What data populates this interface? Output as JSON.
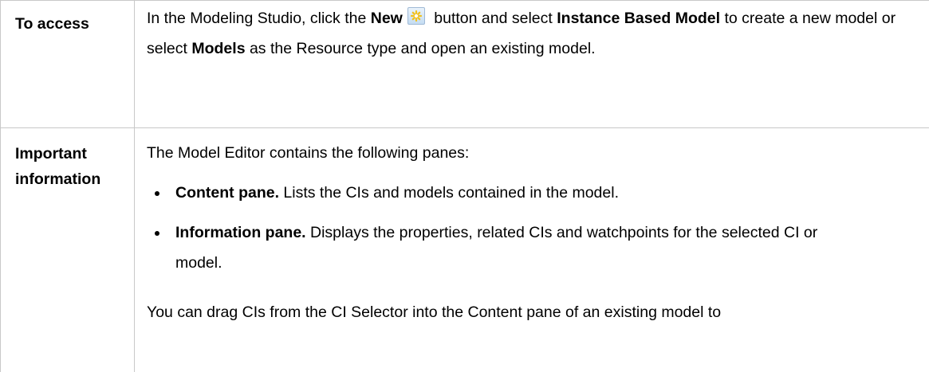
{
  "table": {
    "rows": [
      {
        "label": "To access",
        "content": {
          "text_1": "In the Modeling Studio, click the ",
          "bold_1": "New",
          "icon": "new-star-icon",
          "text_2": " button and select ",
          "bold_2": "Instance Based Model",
          "text_3": " to create a new model or select ",
          "bold_3": "Models",
          "text_4": " as the Resource type and open an existing model."
        }
      },
      {
        "label": "Important information",
        "content": {
          "intro": "The Model Editor contains the following panes:",
          "bullets": [
            {
              "bold": "Content pane.",
              "text": " Lists the CIs and models contained in the model."
            },
            {
              "bold": "Information pane.",
              "text": " Displays the properties, related CIs and watchpoints for the selected CI or model."
            }
          ],
          "trailing": "You can drag CIs from the CI Selector into the Content pane of an existing model to"
        }
      }
    ]
  },
  "colors": {
    "border": "#c8c8c8",
    "icon_star": "#f2c11d"
  }
}
